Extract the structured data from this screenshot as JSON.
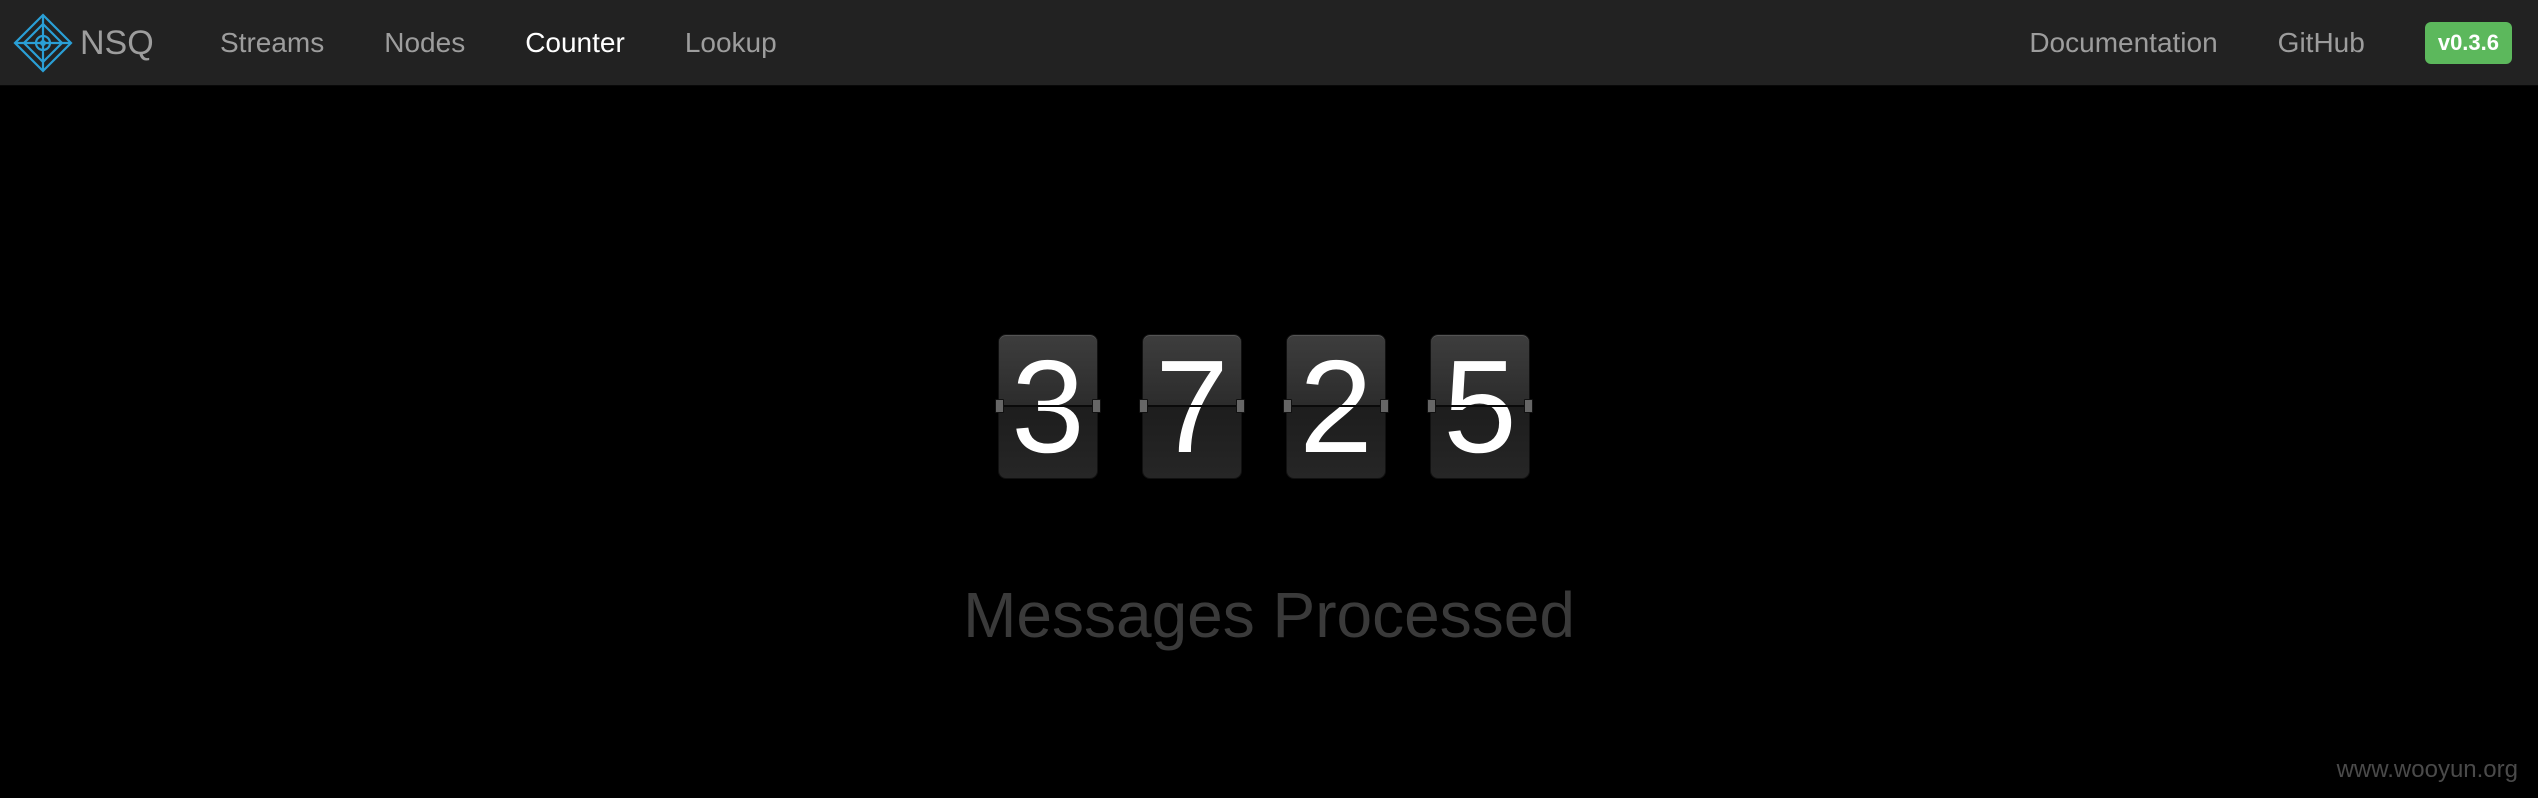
{
  "navbar": {
    "brand": {
      "label": "NSQ",
      "icon": "nsq-logo-icon",
      "icon_color": "#2a9fd6"
    },
    "left_links": [
      {
        "label": "Streams",
        "active": false
      },
      {
        "label": "Nodes",
        "active": false
      },
      {
        "label": "Counter",
        "active": true
      },
      {
        "label": "Lookup",
        "active": false
      }
    ],
    "right_links": [
      {
        "label": "Documentation"
      },
      {
        "label": "GitHub"
      }
    ],
    "version": "v0.3.6",
    "version_color": "#5cb85c"
  },
  "counter": {
    "digits": [
      "3",
      "7",
      "2",
      "5"
    ],
    "caption": "Messages Processed"
  },
  "watermark": "www.wooyun.org"
}
